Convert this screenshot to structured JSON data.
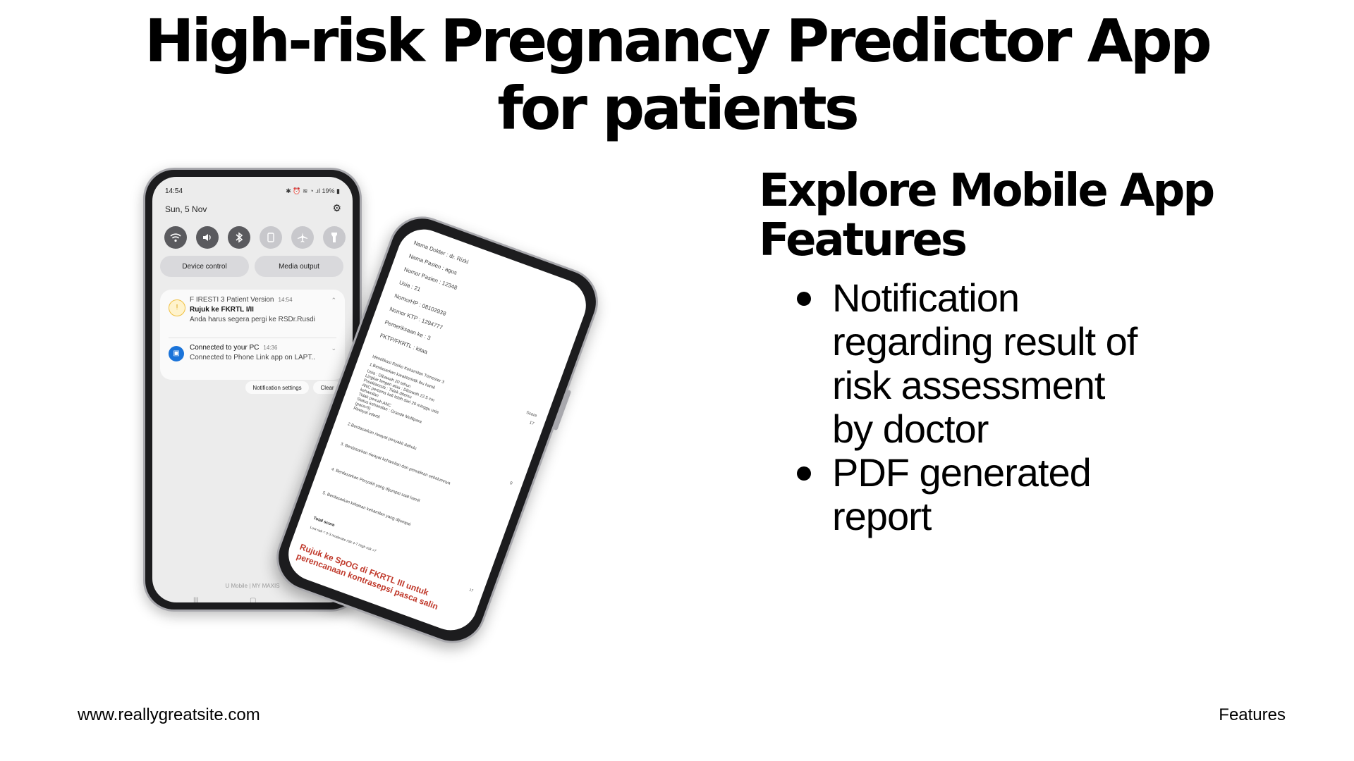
{
  "title": {
    "line1": "High-risk Pregnancy Predictor App",
    "line2": "for patients"
  },
  "features": {
    "heading_line1": "Explore Mobile App",
    "heading_line2": "Features",
    "items": [
      "Notification regarding result of risk assessment by doctor",
      "PDF generated report"
    ]
  },
  "footer": {
    "website": "www.reallygreatsite.com",
    "section": "Features"
  },
  "phone1": {
    "status_time": "14:54",
    "status_icons": "✱ ⏰ ≋ ◔ .ıl 19% ▮",
    "date": "Sun, 5 Nov",
    "pills": [
      "Device control",
      "Media output"
    ],
    "notifications": [
      {
        "app": "F IRESTI 3 Patient Version",
        "time": "14:54",
        "title": "Rujuk ke FKRTL I/II",
        "body": "Anda harus segera pergi ke RSDr.Rusdi"
      },
      {
        "app": "Connected to your PC",
        "time": "14:36",
        "title": "",
        "body": "Connected to Phone Link app on LAPT.."
      }
    ],
    "buttons": [
      "Notification settings",
      "Clear"
    ],
    "carrier": "U Mobile | MY MAXIS"
  },
  "phone2": {
    "fields": [
      "Nama Dokter : dr. Rizki",
      "Nama Pasien : agus",
      "Nomor Pasien : 12348",
      "Usia : 21",
      "NomorHP : 08102938",
      "Nomor KTP : 1294777",
      "Pemeriksaan ke : 3",
      "FKTP/FKRTL : kitaa"
    ],
    "table_header": "Identifikasi Risiko Kehamilan Trimester 3",
    "score_header": "Score",
    "rows": [
      {
        "label": "1.Berdasarkan karakteristik ibu hamil",
        "score": "17"
      },
      {
        "label": "Usia : Dibawah 20 tahun",
        "score": ""
      },
      {
        "label": "Lingkar lengan atas : Dibawah 22.5 cm",
        "score": ""
      },
      {
        "label": "Preeklamsia : Tidak ditemu",
        "score": ""
      },
      {
        "label": "ANC pertama kali lebih dari 20 minggu usia",
        "score": ""
      },
      {
        "label": "kehamilan",
        "score": ""
      },
      {
        "label": "Tidak pernah ANC",
        "score": ""
      },
      {
        "label": "Status kehamilan : Grande Multipara",
        "score": ""
      },
      {
        "label": "(para>5)",
        "score": ""
      },
      {
        "label": "Riwayat infertil",
        "score": ""
      },
      {
        "label": "2.Berdasarkan riwayat penyakit dahulu",
        "score": "0"
      },
      {
        "label": "3. Berdasarkan riwayat kehamilan dan persalinan sebelumnya",
        "score": "0"
      },
      {
        "label": "4. Berdasarkan Penyakit yang dijumpai saat hamil",
        "score": "0"
      },
      {
        "label": "5. Berdasarkan kelainan kehamilan yang dijumpai",
        "score": "0"
      }
    ],
    "total_label": "Total score",
    "legend": "Low risk < 0-3 moderate risk 4-7 High risk >7",
    "total_score": "17",
    "recommendation": "Rujuk ke SpOG di FKRTL III untuk perencanaan kontrasepsi pasca salin"
  }
}
